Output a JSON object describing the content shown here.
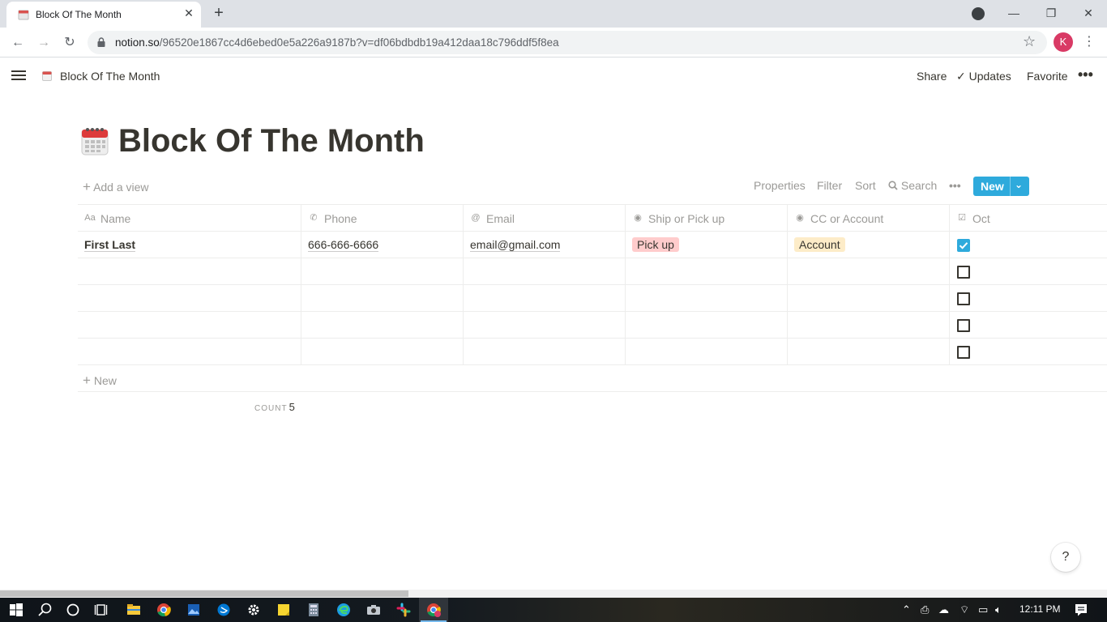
{
  "browser": {
    "tab_title": "Block Of The Month",
    "url_host": "notion.so",
    "url_path": "/96520e1867cc4d6ebed0e5a226a9187b?v=df06bdbdb19a412daa18c796ddf5f8ea",
    "profile_initial": "K",
    "accent": "#d93a65"
  },
  "topbar": {
    "breadcrumb": "Block Of The Month",
    "share": "Share",
    "updates": "Updates",
    "favorite": "Favorite",
    "more": "•••"
  },
  "page": {
    "title": "Block Of The Month",
    "icon": "calendar-icon"
  },
  "viewbar": {
    "add_view": "Add a view",
    "properties": "Properties",
    "filter": "Filter",
    "sort": "Sort",
    "search": "Search",
    "more": "•••",
    "new": "New",
    "new_color": "#2eaadc"
  },
  "table": {
    "columns": [
      {
        "label": "Name",
        "icon": "text-title-icon"
      },
      {
        "label": "Phone",
        "icon": "phone-icon"
      },
      {
        "label": "Email",
        "icon": "at-icon"
      },
      {
        "label": "Ship or Pick up",
        "icon": "select-icon"
      },
      {
        "label": "CC or Account",
        "icon": "select-icon"
      },
      {
        "label": "Oct",
        "icon": "checkbox-icon"
      }
    ],
    "rows": [
      {
        "name": "First Last",
        "phone": "666-666-6666",
        "email": "email@gmail.com",
        "ship": "Pick up",
        "ship_color": "#ffcccc",
        "account": "Account",
        "account_color": "#fdecc8",
        "oct": true
      },
      {
        "name": "",
        "phone": "",
        "email": "",
        "ship": "",
        "account": "",
        "oct": false
      },
      {
        "name": "",
        "phone": "",
        "email": "",
        "ship": "",
        "account": "",
        "oct": false
      },
      {
        "name": "",
        "phone": "",
        "email": "",
        "ship": "",
        "account": "",
        "oct": false
      },
      {
        "name": "",
        "phone": "",
        "email": "",
        "ship": "",
        "account": "",
        "oct": false
      }
    ],
    "add_row": "New",
    "count_label": "COUNT",
    "count_value": "5"
  },
  "help": "?",
  "taskbar": {
    "time": "12:11 PM"
  }
}
